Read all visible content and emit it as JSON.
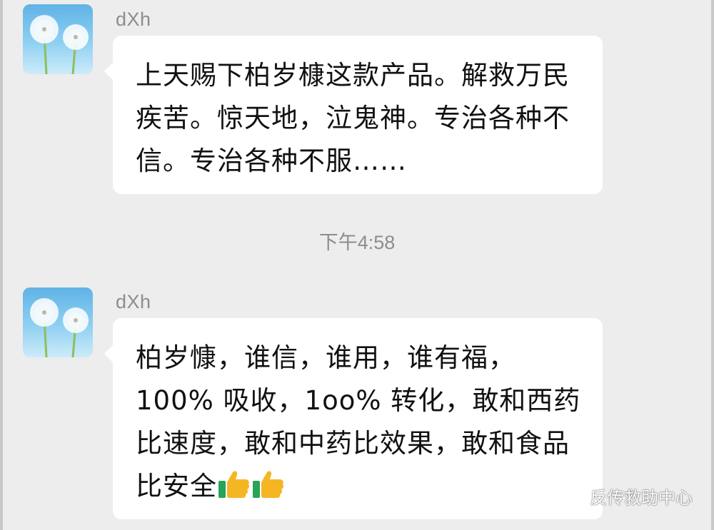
{
  "messages": [
    {
      "sender": "dXh",
      "text": "上天赐下柏岁槺这款产品。解救万民疾苦。惊天地，泣鬼神。专治各种不信。专治各种不服……",
      "emojis": []
    },
    {
      "sender": "dXh",
      "text": "柏岁慷，谁信，谁用，谁有福，100% 吸收，1oo% 转化，敢和西药比速度，敢和中药比效果，敢和食品比安全",
      "emojis": [
        "thumbs-up-icon",
        "thumbs-up-icon"
      ]
    }
  ],
  "timestamp": "下午4:58",
  "watermark": {
    "icon": "wechat-icon",
    "text": "反传救助中心"
  },
  "colors": {
    "background": "#ededed",
    "bubble": "#ffffff",
    "sender": "#8d8d8d",
    "timestamp": "#8d8d8d"
  }
}
